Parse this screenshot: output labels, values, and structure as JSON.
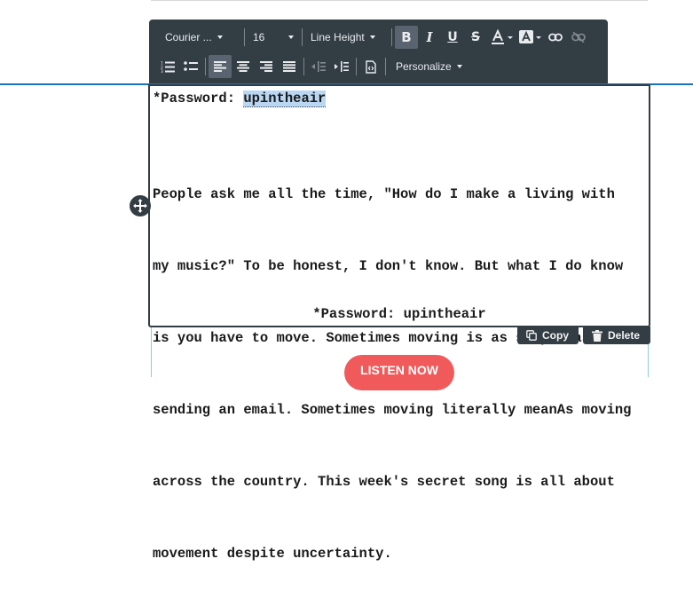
{
  "toolbar": {
    "font_family": "Courier ...",
    "font_size": "16",
    "line_height": "Line Height",
    "personalize": "Personalize"
  },
  "editor": {
    "password_label": "*Password: ",
    "password_value": "upintheair",
    "paragraph_lines": [
      "People ask me all the time, \"How do I make a living with",
      "my music?\" To be honest, I don't know. But what I do know",
      "is you have to move. Sometimes moving is as simple as",
      "sending an email. Sometimes moving literally meanAs moving",
      "across the country. This week's secret song is all about",
      "movement despite uncertainty."
    ],
    "password_centered": "*Password: upintheair"
  },
  "actions": {
    "copy_label": "Copy",
    "delete_label": "Delete"
  },
  "cta": {
    "listen_label": "LISTEN NOW"
  },
  "colors": {
    "toolbar_bg": "#333d44",
    "guide_blue": "#1b72c0",
    "cta_red": "#f05a5b",
    "selection": "#b9d6f2"
  }
}
